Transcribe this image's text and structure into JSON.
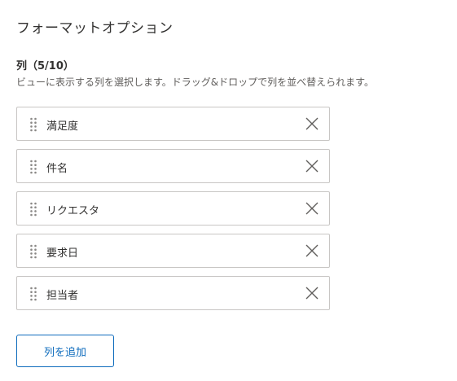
{
  "panel": {
    "title": "フォーマットオプション"
  },
  "columns_section": {
    "heading": "列（5/10）",
    "description": "ビューに表示する列を選択します。ドラッグ&ドロップで列を並べ替えられます。",
    "items": [
      {
        "label": "満足度",
        "handle_icon": "drag-handle-icon",
        "remove_icon": "close-icon"
      },
      {
        "label": "件名",
        "handle_icon": "drag-handle-icon",
        "remove_icon": "close-icon"
      },
      {
        "label": "リクエスタ",
        "handle_icon": "drag-handle-icon",
        "remove_icon": "close-icon"
      },
      {
        "label": "要求日",
        "handle_icon": "drag-handle-icon",
        "remove_icon": "close-icon"
      },
      {
        "label": "担当者",
        "handle_icon": "drag-handle-icon",
        "remove_icon": "close-icon"
      }
    ],
    "add_button_label": "列を追加"
  },
  "colors": {
    "accent": "#0f6cbd",
    "border": "#c8c6c4",
    "text": "#323130",
    "muted_text": "#605e5c",
    "icon": "#605e5c"
  }
}
